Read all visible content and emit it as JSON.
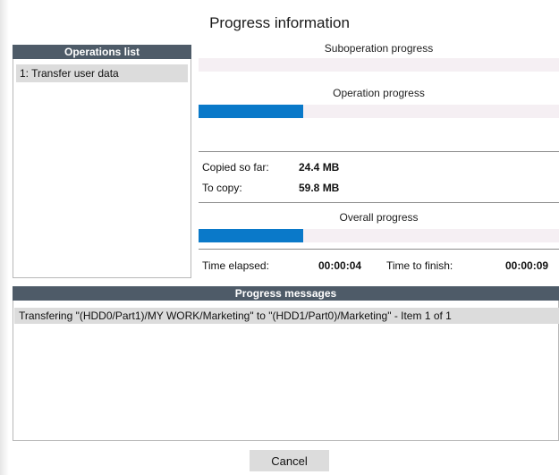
{
  "window": {
    "title": "Progress information"
  },
  "operations": {
    "header": "Operations list",
    "items": [
      {
        "label": "1: Transfer user data"
      }
    ]
  },
  "progress": {
    "suboperation": {
      "label": "Suboperation progress",
      "fraction": 0.0
    },
    "operation": {
      "label": "Operation progress",
      "fraction": 0.29
    },
    "overall": {
      "label": "Overall progress",
      "fraction": 0.29
    },
    "copied_label": "Copied so far:",
    "copied_value": "24.4 MB",
    "tocopy_label": "To copy:",
    "tocopy_value": "59.8 MB",
    "elapsed_label": "Time elapsed:",
    "elapsed_value": "00:00:04",
    "finish_label": "Time to finish:",
    "finish_value": "00:00:09"
  },
  "messages": {
    "header": "Progress messages",
    "items": [
      {
        "text": "Transfering \"(HDD0/Part1)/MY WORK/Marketing\" to \"(HDD1/Part0)/Marketing\" - Item 1 of 1"
      }
    ]
  },
  "buttons": {
    "cancel": "Cancel"
  },
  "colors": {
    "header_bg": "#4e5b68",
    "progress_fill": "#0a79c9",
    "track_bg": "#f5eff3",
    "selection_bg": "#dcdcdc"
  }
}
